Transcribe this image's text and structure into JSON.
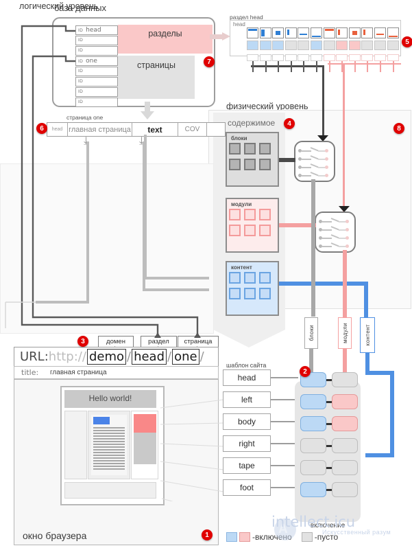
{
  "levels": {
    "logical": "логический уровень",
    "physical": "физический уровень"
  },
  "database": {
    "title": "база данных",
    "sections_block_label": "разделы",
    "pages_block_label": "страницы",
    "id_label": "ID",
    "section_rows": [
      {
        "id": "ID",
        "name": "head"
      },
      {
        "id": "ID",
        "name": ""
      },
      {
        "id": "ID",
        "name": ""
      }
    ],
    "page_rows": [
      {
        "id": "ID",
        "name": "one"
      },
      {
        "id": "ID",
        "name": ""
      },
      {
        "id": "ID",
        "name": ""
      },
      {
        "id": "ID",
        "name": ""
      },
      {
        "id": "ID",
        "name": ""
      }
    ]
  },
  "head_section": {
    "caption": "раздел head",
    "inner_label": "head",
    "thumbnails": [
      {
        "accent": "blue",
        "state": "on"
      },
      {
        "accent": "blue",
        "state": "on"
      },
      {
        "accent": "blue",
        "state": "on"
      },
      {
        "accent": "blue",
        "state": "empty"
      },
      {
        "accent": "blue",
        "state": "empty"
      },
      {
        "accent": "blue",
        "state": "on"
      },
      {
        "accent": "red",
        "state": "empty"
      },
      {
        "accent": "red",
        "state": "on"
      },
      {
        "accent": "red",
        "state": "on"
      },
      {
        "accent": "red",
        "state": "empty"
      },
      {
        "accent": "red",
        "state": "empty"
      },
      {
        "accent": "red",
        "state": "empty"
      }
    ]
  },
  "page_one": {
    "caption": "страница one",
    "cells": [
      "head",
      "главная страница",
      "text",
      "COV",
      ""
    ]
  },
  "content": {
    "title": "содержимое",
    "groups": [
      {
        "label": "блоки",
        "color": "gray"
      },
      {
        "label": "модули",
        "color": "pink"
      },
      {
        "label": "контент",
        "color": "blue"
      }
    ]
  },
  "pipe_labels": [
    {
      "text": "блоки",
      "color": "gray"
    },
    {
      "text": "модули",
      "color": "pink"
    },
    {
      "text": "контент",
      "color": "blue"
    }
  ],
  "url": {
    "tags": [
      "домен",
      "раздел",
      "страница"
    ],
    "prefix_label": "URL:",
    "scheme": "http://",
    "domain": "demo",
    "section": "head",
    "page": "one",
    "trailing_slash": "/",
    "title_label": "title:",
    "title_value": "главная страница"
  },
  "browser": {
    "caption": "окно браузера",
    "page_heading": "Hello world!"
  },
  "template": {
    "caption": "шаблон сайта",
    "rows": [
      {
        "name": "head",
        "left": "on",
        "right": "empty"
      },
      {
        "name": "left",
        "left": "on",
        "right": "pink"
      },
      {
        "name": "body",
        "left": "on",
        "right": "pink"
      },
      {
        "name": "right",
        "left": "empty",
        "right": "empty"
      },
      {
        "name": "tape",
        "left": "empty",
        "right": "empty"
      },
      {
        "name": "foot",
        "left": "on",
        "right": "empty"
      }
    ],
    "switch_label": "включение"
  },
  "legend": {
    "on_label": "-включено",
    "empty_label": "-пусто"
  },
  "badges": [
    "1",
    "2",
    "3",
    "4",
    "5",
    "6",
    "7",
    "8"
  ],
  "watermark": {
    "main": "intellect.icu",
    "sub": "Искусственный разум",
    "mark": "A"
  },
  "colors": {
    "red_badge": "#e00000",
    "blue": "#4f90e2",
    "pink": "#f4a0a0",
    "gray": "#a8a8a8",
    "blue_fill": "#bcd9f5",
    "pink_fill": "#fac8c8",
    "gray_fill": "#e2e2e2"
  }
}
